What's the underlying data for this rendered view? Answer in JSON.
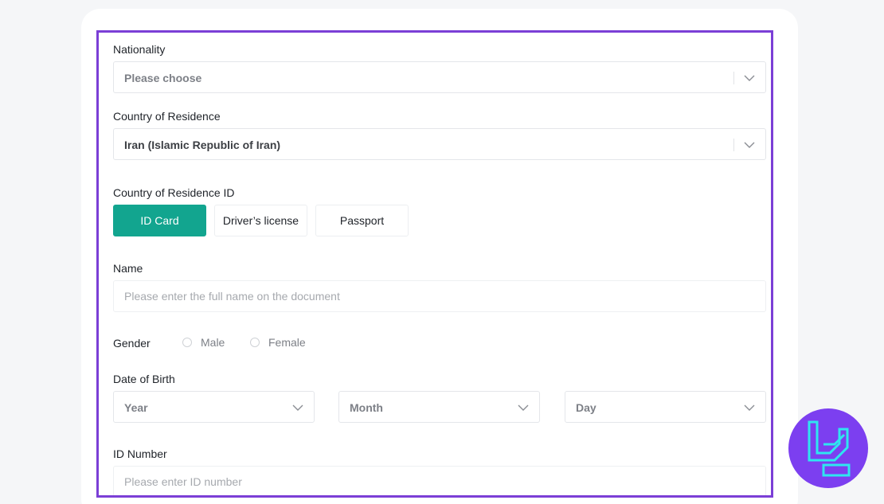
{
  "form": {
    "nationality": {
      "label": "Nationality",
      "placeholder": "Please choose"
    },
    "residence": {
      "label": "Country of Residence",
      "value": "Iran (Islamic Republic of Iran)"
    },
    "residence_id": {
      "label": "Country of Residence ID",
      "options": [
        "ID Card",
        "Driver’s license",
        "Passport"
      ],
      "selected": "ID Card"
    },
    "name": {
      "label": "Name",
      "placeholder": "Please enter the full name on the document"
    },
    "gender": {
      "label": "Gender",
      "options": [
        "Male",
        "Female"
      ]
    },
    "dob": {
      "label": "Date of Birth",
      "year": "Year",
      "month": "Month",
      "day": "Day"
    },
    "id_number": {
      "label": "ID Number",
      "placeholder": "Please enter ID number"
    }
  },
  "colors": {
    "accent": "#12a58f",
    "highlight_border": "#7b3fd6",
    "logo_bg": "#7c3ff0",
    "logo_fg": "#2ee6f0"
  },
  "icons": {
    "select_arrow": "chevron-down-icon",
    "logo": "brand-logo-icon"
  }
}
